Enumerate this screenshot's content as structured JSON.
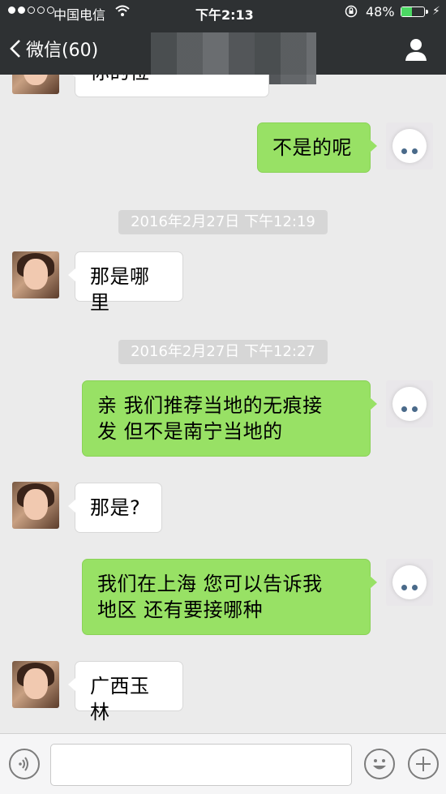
{
  "status_bar": {
    "carrier": "中国电信",
    "time": "下午2:13",
    "battery": "48%",
    "battery_level": 0.48,
    "accent": "#4cd964"
  },
  "nav": {
    "back_label": "微信(60)",
    "profile_icon": "person-icon"
  },
  "messages": [
    {
      "type": "in",
      "text": "你的位"
    },
    {
      "type": "out",
      "text": "不是的呢"
    },
    {
      "type": "time",
      "text": "2016年2月27日 下午12:19"
    },
    {
      "type": "in",
      "text": "那是哪里"
    },
    {
      "type": "time",
      "text": "2016年2月27日 下午12:27"
    },
    {
      "type": "out",
      "lines": [
        "亲 我们推荐当地的无痕接",
        "发 但不是南宁当地的"
      ]
    },
    {
      "type": "in",
      "text": "那是?"
    },
    {
      "type": "out",
      "lines": [
        "我们在上海 您可以告诉我",
        "地区 还有要接哪种"
      ]
    },
    {
      "type": "in",
      "text": "广西玉林"
    }
  ],
  "colors": {
    "out_bubble": "#98e165",
    "in_bubble": "#ffffff",
    "header": "#2e3133"
  },
  "input_bar": {
    "voice_icon": "voice-icon",
    "emoji_icon": "emoji-icon",
    "plus_icon": "plus-icon",
    "input_value": ""
  }
}
